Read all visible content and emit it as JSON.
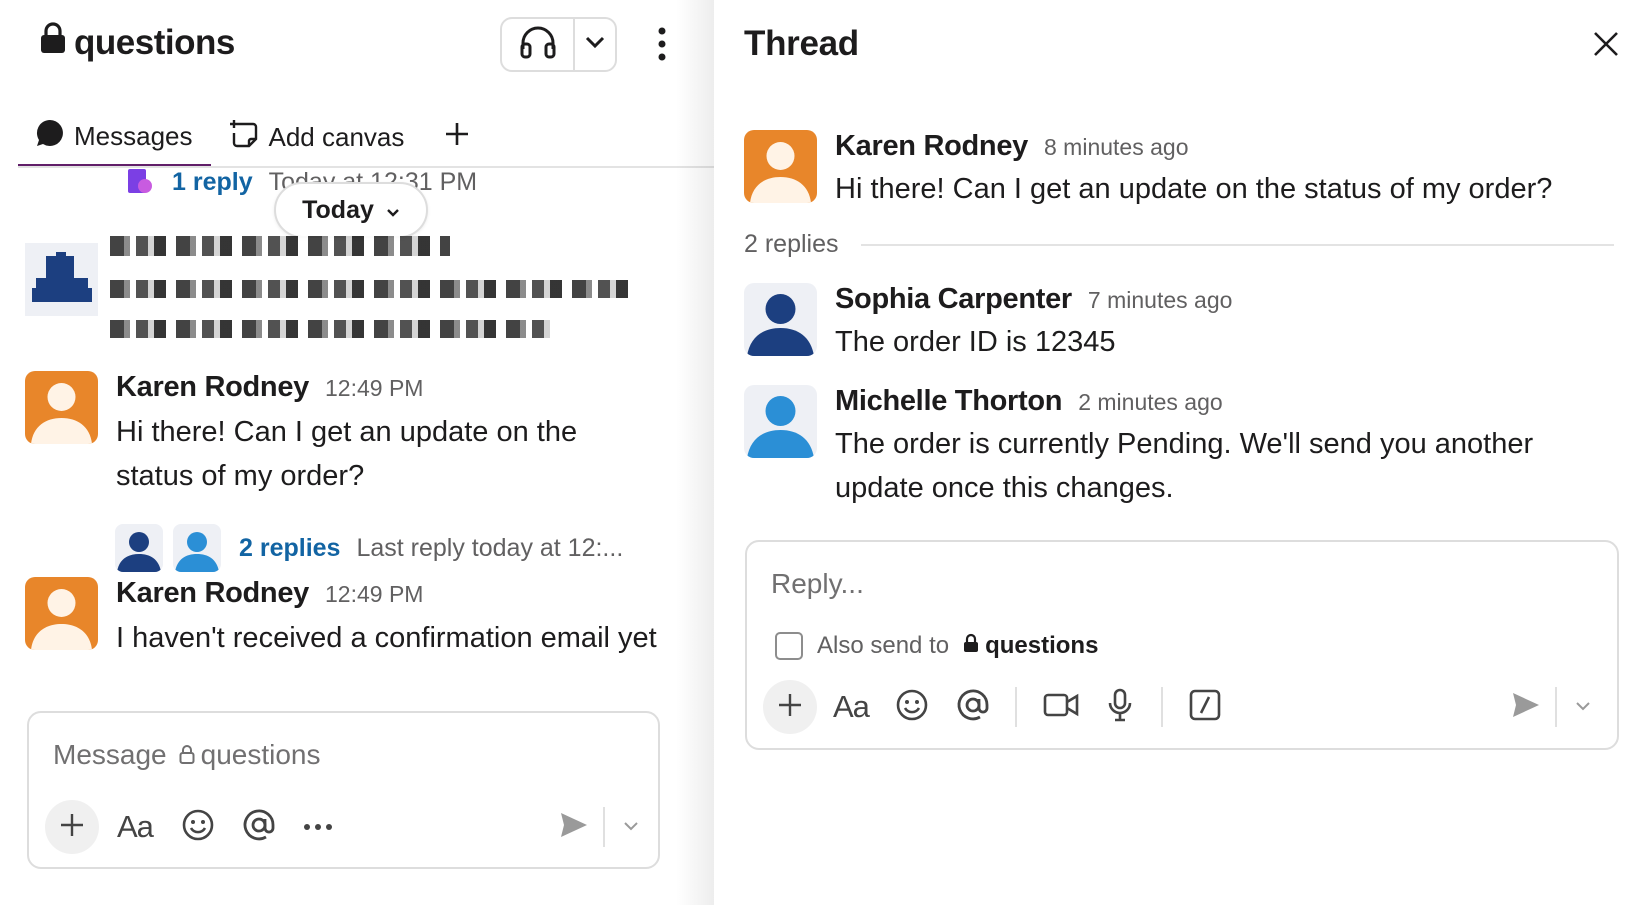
{
  "channel": {
    "name": "questions",
    "tabs": [
      {
        "label": "Messages"
      },
      {
        "label": "Add canvas"
      }
    ]
  },
  "feed": {
    "prev_reply": {
      "count": "1 reply",
      "timestamp": "Today at 12:31 PM"
    },
    "date_pill": "Today",
    "messages": [
      {
        "author": "Karen Rodney",
        "time": "12:49 PM",
        "text": "Hi there! Can I get an update on the status of my order?",
        "replies": "2 replies",
        "last_reply": "Last reply today at 12:..."
      },
      {
        "author": "Karen Rodney",
        "time": "12:49 PM",
        "text": "I haven't received a confirmation email yet"
      }
    ]
  },
  "composer": {
    "placeholder_prefix": "Message",
    "channel": "questions",
    "format_label": "Aa"
  },
  "thread": {
    "title": "Thread",
    "parent": {
      "author": "Karen Rodney",
      "time": "8 minutes ago",
      "text": "Hi there! Can I get an update on the status of my order?"
    },
    "reply_count": "2 replies",
    "replies": [
      {
        "author": "Sophia Carpenter",
        "time": "7 minutes ago",
        "text": "The order ID is 12345"
      },
      {
        "author": "Michelle Thorton",
        "time": "2 minutes ago",
        "text": "The order is currently Pending. We'll send you another update once this changes."
      }
    ],
    "reply_box": {
      "placeholder": "Reply...",
      "also_send_label": "Also send to",
      "also_send_channel": "questions",
      "format_label": "Aa"
    }
  },
  "colors": {
    "accent_purple": "#611f69",
    "link_blue": "#1264a3",
    "avatar_orange": "#e8862a",
    "avatar_navy": "#1c3f80",
    "avatar_sky": "#2b8fd6"
  },
  "icons": [
    "lock-icon",
    "headphones-icon",
    "chevron-down-icon",
    "kebab-icon",
    "message-bubble-icon",
    "add-canvas-icon",
    "plus-icon",
    "emoji-icon",
    "mention-icon",
    "more-icon",
    "send-icon",
    "close-icon",
    "video-icon",
    "mic-icon",
    "slash-icon"
  ]
}
